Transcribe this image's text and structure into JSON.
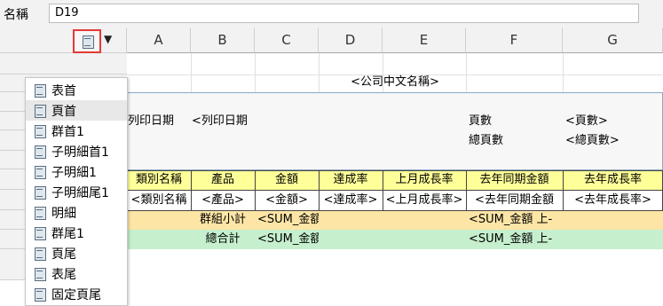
{
  "namebar": {
    "label": "名稱",
    "value": "D19"
  },
  "columns": [
    "A",
    "B",
    "C",
    "D",
    "E",
    "F",
    "G"
  ],
  "band_menu": {
    "items": [
      "表首",
      "頁首",
      "群首1",
      "子明細首1",
      "子明細1",
      "子明細尾1",
      "明細",
      "群尾1",
      "頁尾",
      "表尾",
      "固定頁尾"
    ],
    "highlighted": "頁首"
  },
  "report": {
    "title": "<公司中文名稱>",
    "print_date_label": "列印日期",
    "print_date_value": "<列印日期",
    "pages_label": "頁數",
    "pages_value": "<頁數>",
    "total_pages_label": "總頁數",
    "total_pages_value": "<總頁數>",
    "headers": [
      "類別名稱",
      "產品",
      "金額",
      "達成率",
      "上月成長率",
      "去年同期金額",
      "去年成長率"
    ],
    "detail": [
      "<類別名稱",
      "<產品>",
      "<金額>",
      "<達成率>",
      "<上月成長率>",
      "<去年同期金額",
      "<去年成長率>"
    ],
    "group_footer": {
      "label": "群組小計",
      "amount": "<SUM_金額",
      "last_year": "<SUM_金額 上-"
    },
    "grand_total": {
      "label": "總合計",
      "amount": "<SUM_金額",
      "last_year": "<SUM_金額 上-"
    }
  },
  "colors": {
    "header_band": "#ffff99",
    "group_band": "#fde5a6",
    "total_band": "#c6efce",
    "menu_highlight": "#e8e8e8"
  }
}
